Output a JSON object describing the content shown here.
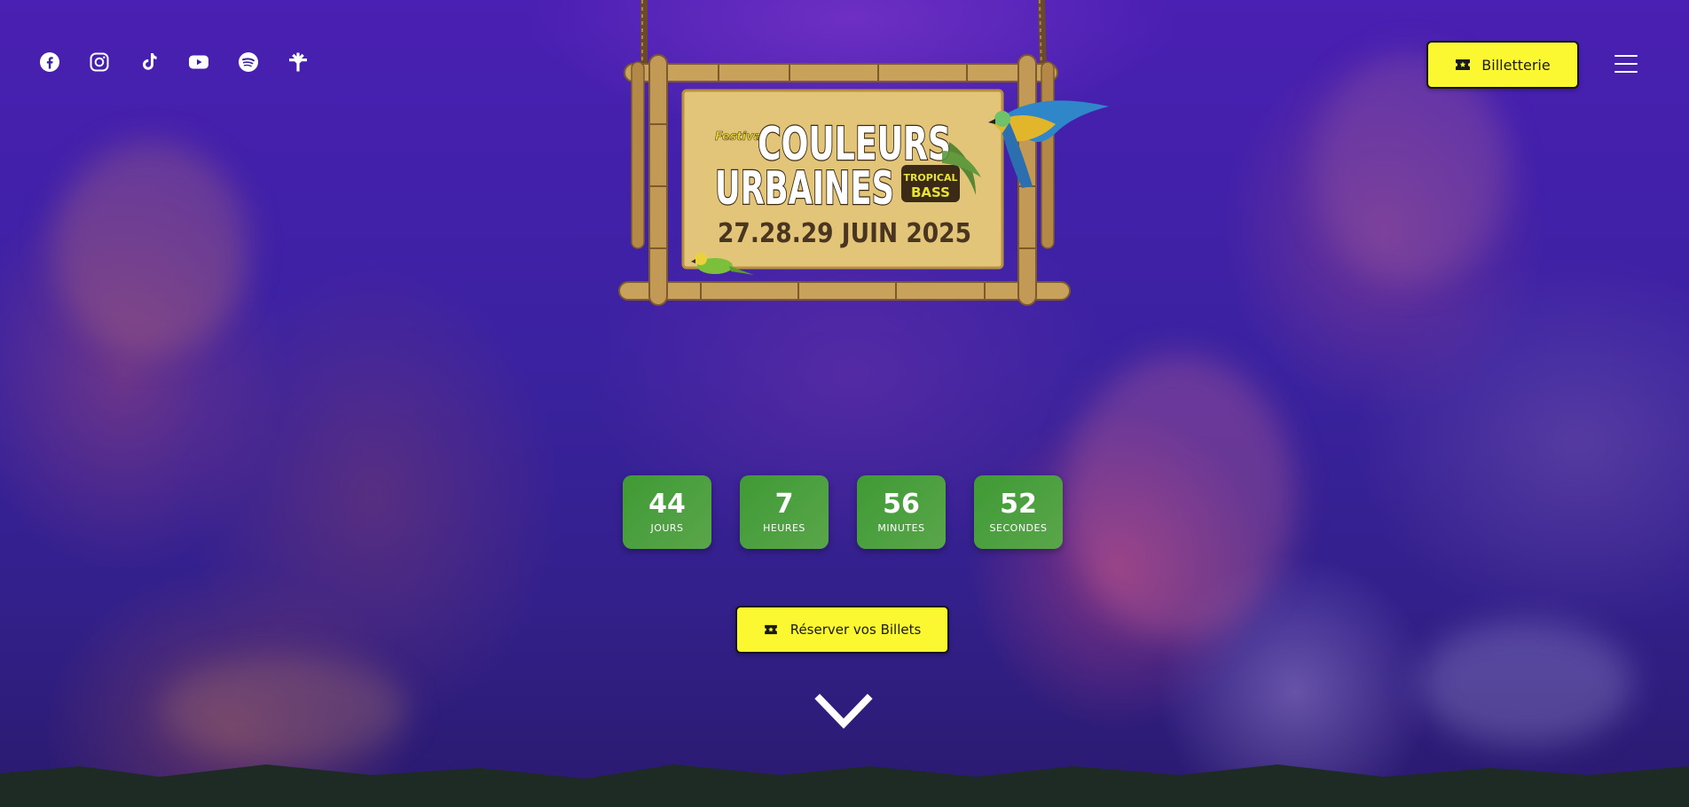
{
  "brand": {
    "logo_prefix": "Festival",
    "logo_line1": "COULEURS",
    "logo_line2": "URBAINES",
    "logo_badge_line1": "TROPICAL",
    "logo_badge_line2": "BASS",
    "logo_dates": "27.28.29 JUIN 2025"
  },
  "social": [
    "facebook-icon",
    "instagram-icon",
    "tiktok-icon",
    "youtube-icon",
    "spotify-icon",
    "linktree-icon"
  ],
  "header": {
    "ticket_button_label": "Billetterie",
    "ticket_icon": "ticket-icon",
    "menu_icon": "menu-icon"
  },
  "countdown": {
    "days": {
      "value": "44",
      "label": "JOURS"
    },
    "hours": {
      "value": "7",
      "label": "HEURES"
    },
    "minutes": {
      "value": "56",
      "label": "MINUTES"
    },
    "seconds": {
      "value": "52",
      "label": "SECONDES"
    }
  },
  "cta": {
    "reserve_label": "Réserver vos Billets",
    "reserve_icon": "ticket-icon",
    "scroll_icon": "chevron-down-icon"
  },
  "colors": {
    "accent_yellow": "#fbf730",
    "countdown_green": "#4c9e3e",
    "background_purple": "#3a22a0",
    "footer_dark_green": "#1d2b24"
  }
}
